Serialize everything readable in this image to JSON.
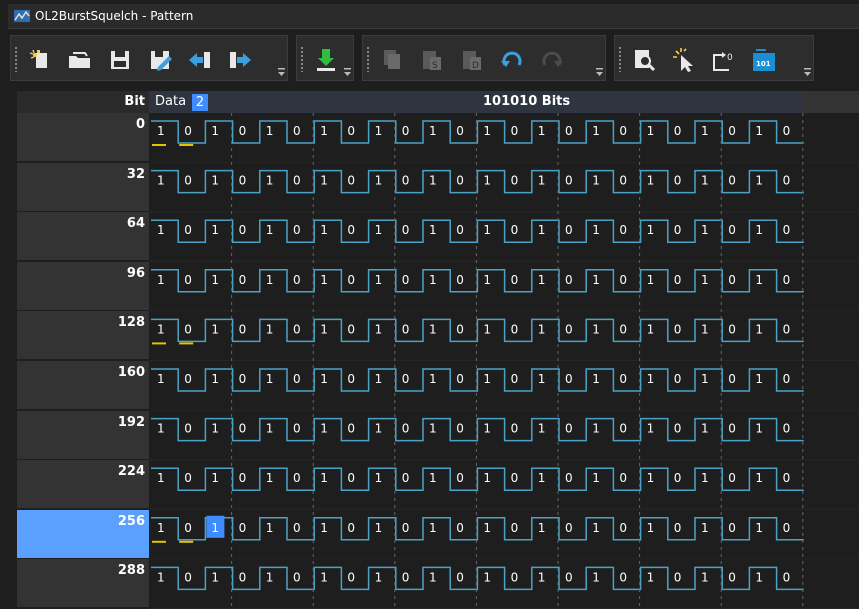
{
  "window": {
    "title": "OL2BurstSquelch - Pattern"
  },
  "toolbar": {
    "groups": [
      {
        "buttons": [
          "new-pattern-icon",
          "open-folder-icon",
          "save-icon",
          "save-as-icon",
          "import-left-icon",
          "export-right-icon"
        ]
      },
      {
        "buttons": [
          "download-icon"
        ]
      },
      {
        "buttons": [
          "copy-icon",
          "paste-special-icon",
          "paste-data-icon",
          "undo-icon",
          "redo-icon"
        ]
      },
      {
        "buttons": [
          "zoom-find-icon",
          "select-pointer-icon",
          "set-zero-icon",
          "binary-view-icon"
        ]
      }
    ]
  },
  "grid": {
    "header": {
      "bit_label": "Bit",
      "data_label": "Data",
      "selected_column": "2",
      "pattern_title": "101010 Bits"
    },
    "bits_per_row": 32,
    "visible_bits_per_row": 24,
    "rows": [
      {
        "label": "0",
        "bits": "101010101010101010101010",
        "markers": [
          0,
          1
        ]
      },
      {
        "label": "32",
        "bits": "101010101010101010101010",
        "markers": []
      },
      {
        "label": "64",
        "bits": "101010101010101010101010",
        "markers": []
      },
      {
        "label": "96",
        "bits": "101010101010101010101010",
        "markers": []
      },
      {
        "label": "128",
        "bits": "101010101010101010101010",
        "markers": [
          0,
          1
        ]
      },
      {
        "label": "160",
        "bits": "101010101010101010101010",
        "markers": []
      },
      {
        "label": "192",
        "bits": "101010101010101010101010",
        "markers": []
      },
      {
        "label": "224",
        "bits": "101010101010101010101010",
        "markers": []
      },
      {
        "label": "256",
        "bits": "101010101010101010101010",
        "markers": [
          0,
          1
        ],
        "selected_bit": 2,
        "selected": true
      },
      {
        "label": "288",
        "bits": "101010101010101010101010",
        "markers": []
      }
    ]
  },
  "colors": {
    "wave": "#4aa3c7",
    "marker": "#e6c200",
    "selection": "#3f8cff",
    "row_selected": "#5aa1ff",
    "divider": "#666666"
  }
}
